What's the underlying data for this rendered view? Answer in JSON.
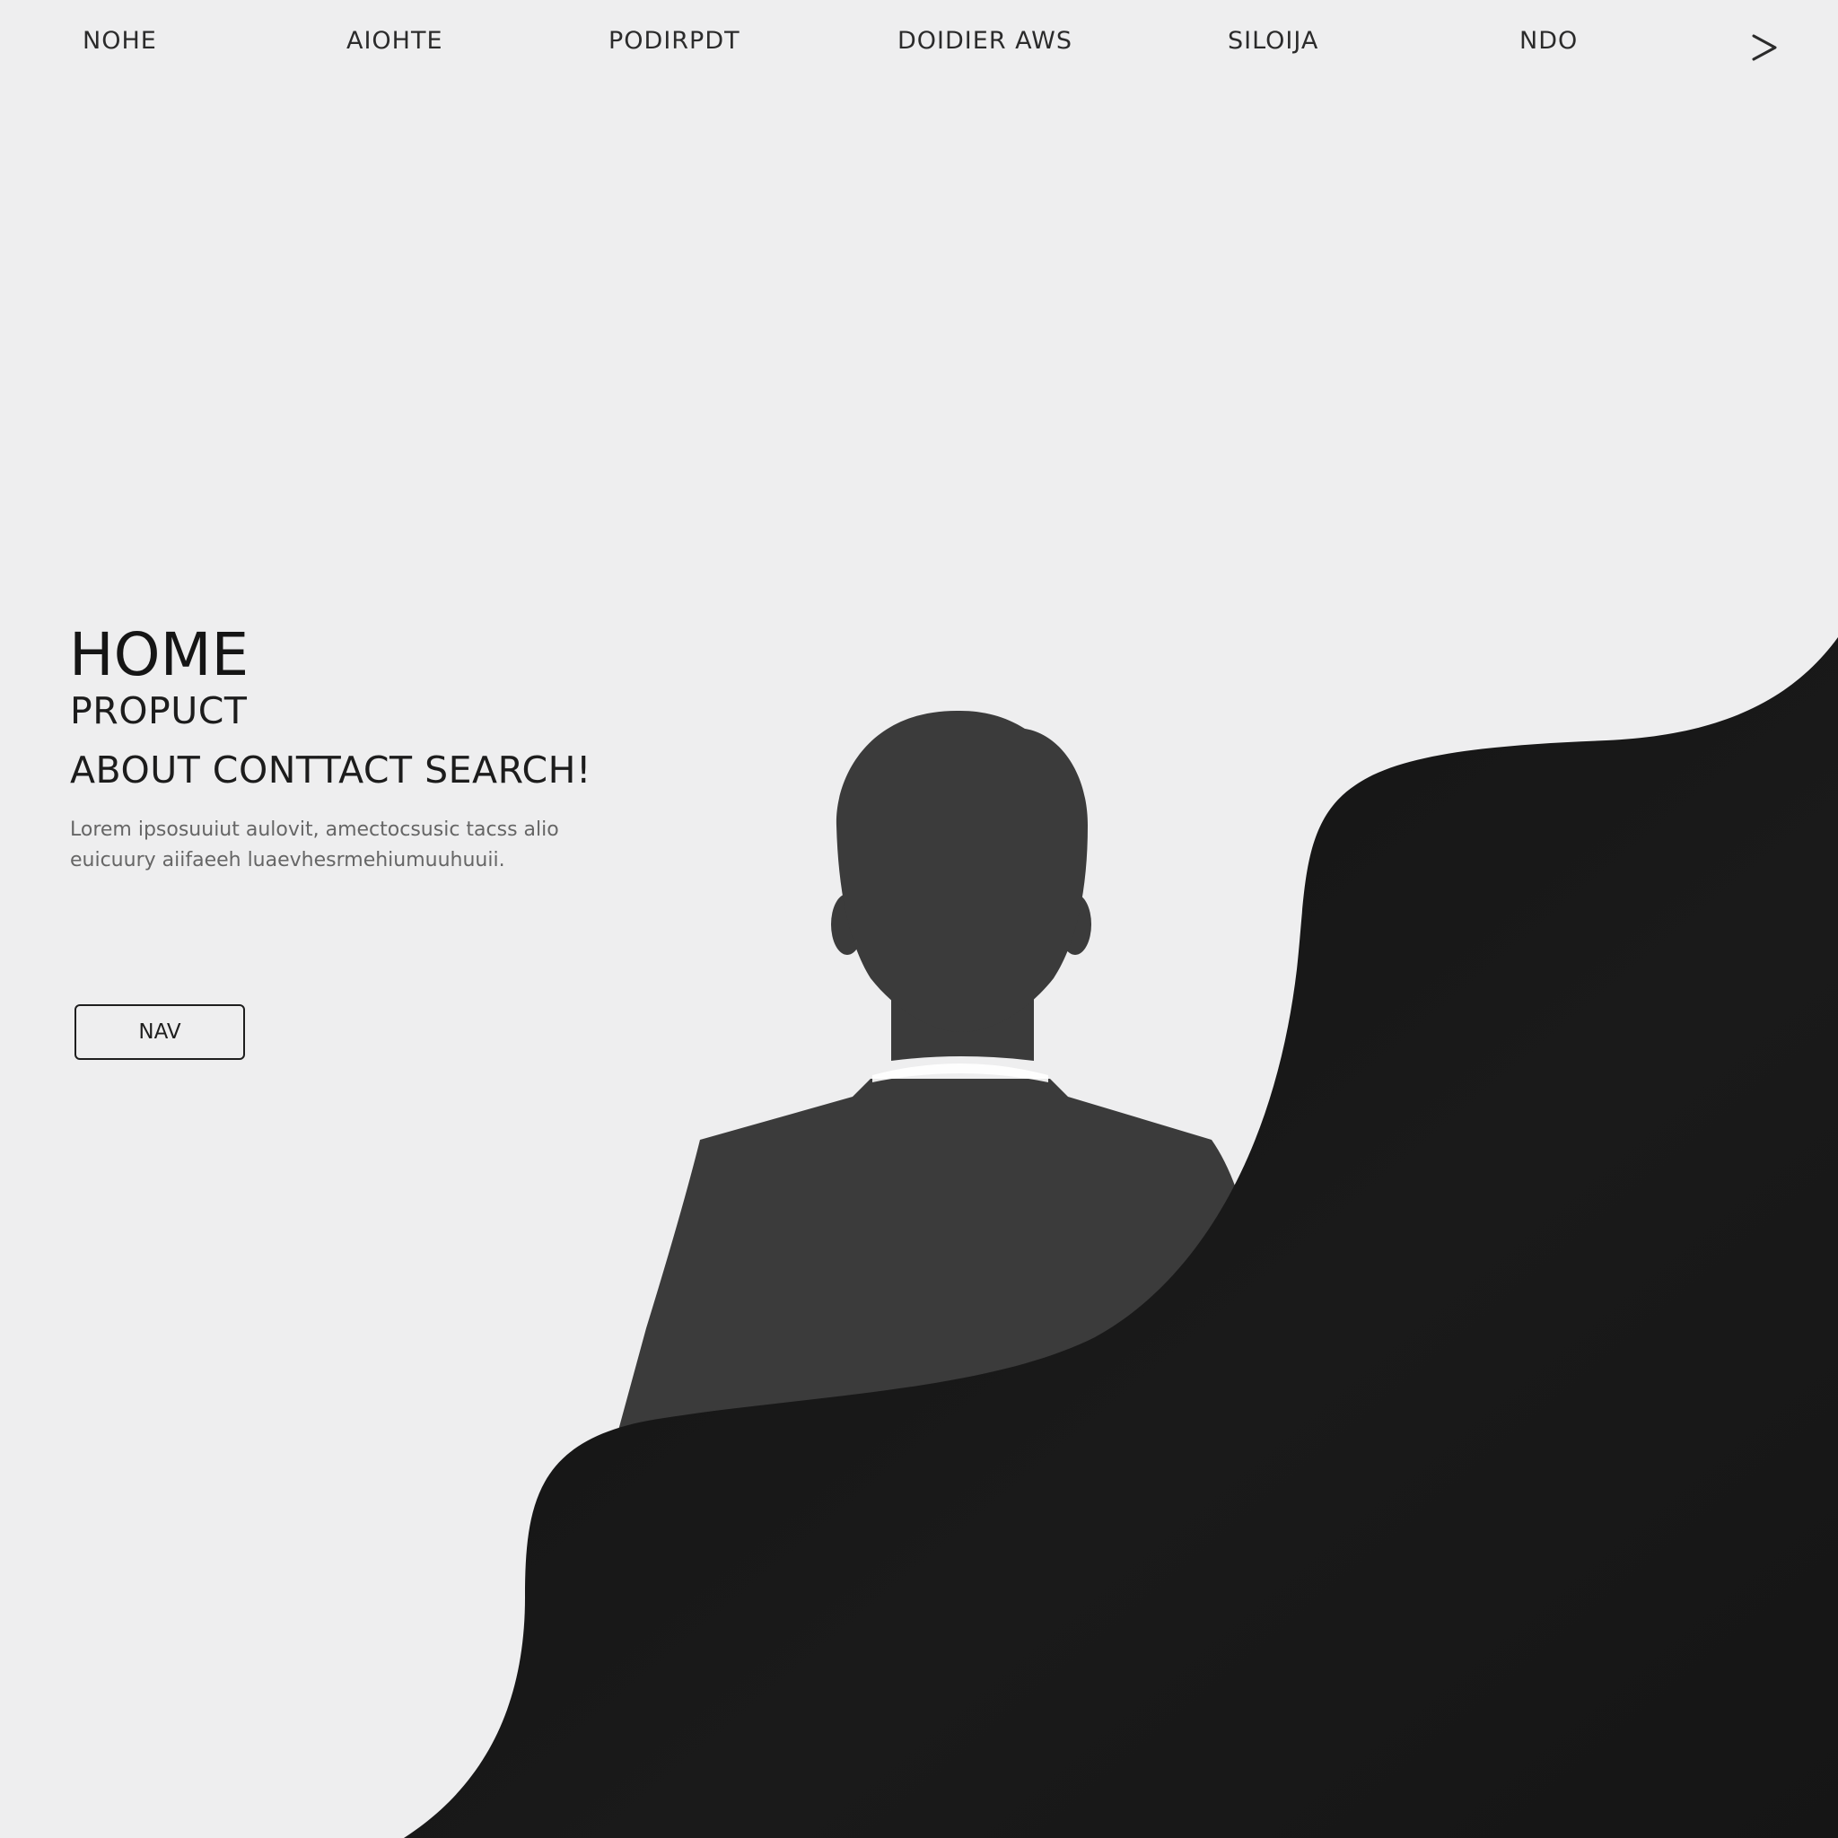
{
  "nav": {
    "items": [
      "NOHE",
      "AIOHTE",
      "PODIRPDT",
      "DOIDIER AWS",
      "SILOIJA",
      "NDO"
    ],
    "next_icon": "chevron-right-icon"
  },
  "hero": {
    "title": "HOME",
    "subtitle_1": "PROPUCT",
    "subtitle_2": "ABOUT CONTTACT SEARCH!",
    "body": "Lorem ipsosuuiut aulovit, amectocsusic tacss alio euicuury aiifaeeh luaevhesrmehiumuuhuuii.",
    "button_label": "NAV"
  },
  "illustration": {
    "subject": "person-silhouette",
    "silhouette_color": "#3b3b3b",
    "wave_color": "#141414",
    "background_color": "#eeeeef"
  }
}
